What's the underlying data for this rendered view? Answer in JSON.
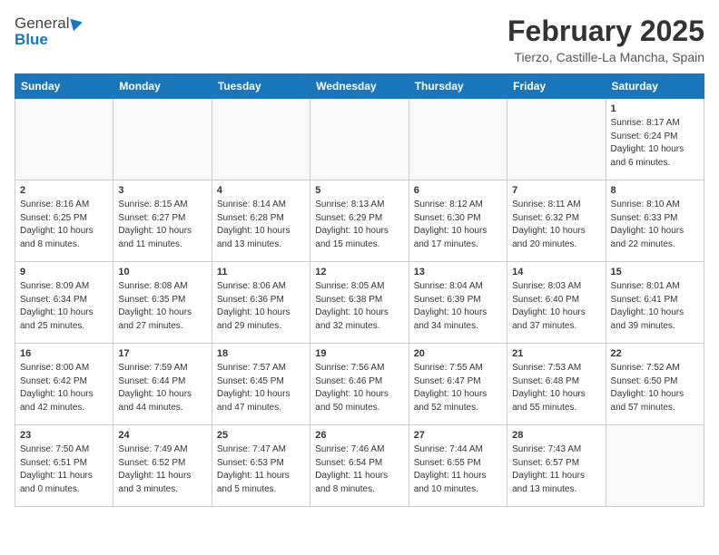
{
  "header": {
    "logo_general": "General",
    "logo_blue": "Blue",
    "month_year": "February 2025",
    "location": "Tierzo, Castille-La Mancha, Spain"
  },
  "weekdays": [
    "Sunday",
    "Monday",
    "Tuesday",
    "Wednesday",
    "Thursday",
    "Friday",
    "Saturday"
  ],
  "weeks": [
    [
      {
        "day": "",
        "info": ""
      },
      {
        "day": "",
        "info": ""
      },
      {
        "day": "",
        "info": ""
      },
      {
        "day": "",
        "info": ""
      },
      {
        "day": "",
        "info": ""
      },
      {
        "day": "",
        "info": ""
      },
      {
        "day": "1",
        "info": "Sunrise: 8:17 AM\nSunset: 6:24 PM\nDaylight: 10 hours\nand 6 minutes."
      }
    ],
    [
      {
        "day": "2",
        "info": "Sunrise: 8:16 AM\nSunset: 6:25 PM\nDaylight: 10 hours\nand 8 minutes."
      },
      {
        "day": "3",
        "info": "Sunrise: 8:15 AM\nSunset: 6:27 PM\nDaylight: 10 hours\nand 11 minutes."
      },
      {
        "day": "4",
        "info": "Sunrise: 8:14 AM\nSunset: 6:28 PM\nDaylight: 10 hours\nand 13 minutes."
      },
      {
        "day": "5",
        "info": "Sunrise: 8:13 AM\nSunset: 6:29 PM\nDaylight: 10 hours\nand 15 minutes."
      },
      {
        "day": "6",
        "info": "Sunrise: 8:12 AM\nSunset: 6:30 PM\nDaylight: 10 hours\nand 17 minutes."
      },
      {
        "day": "7",
        "info": "Sunrise: 8:11 AM\nSunset: 6:32 PM\nDaylight: 10 hours\nand 20 minutes."
      },
      {
        "day": "8",
        "info": "Sunrise: 8:10 AM\nSunset: 6:33 PM\nDaylight: 10 hours\nand 22 minutes."
      }
    ],
    [
      {
        "day": "9",
        "info": "Sunrise: 8:09 AM\nSunset: 6:34 PM\nDaylight: 10 hours\nand 25 minutes."
      },
      {
        "day": "10",
        "info": "Sunrise: 8:08 AM\nSunset: 6:35 PM\nDaylight: 10 hours\nand 27 minutes."
      },
      {
        "day": "11",
        "info": "Sunrise: 8:06 AM\nSunset: 6:36 PM\nDaylight: 10 hours\nand 29 minutes."
      },
      {
        "day": "12",
        "info": "Sunrise: 8:05 AM\nSunset: 6:38 PM\nDaylight: 10 hours\nand 32 minutes."
      },
      {
        "day": "13",
        "info": "Sunrise: 8:04 AM\nSunset: 6:39 PM\nDaylight: 10 hours\nand 34 minutes."
      },
      {
        "day": "14",
        "info": "Sunrise: 8:03 AM\nSunset: 6:40 PM\nDaylight: 10 hours\nand 37 minutes."
      },
      {
        "day": "15",
        "info": "Sunrise: 8:01 AM\nSunset: 6:41 PM\nDaylight: 10 hours\nand 39 minutes."
      }
    ],
    [
      {
        "day": "16",
        "info": "Sunrise: 8:00 AM\nSunset: 6:42 PM\nDaylight: 10 hours\nand 42 minutes."
      },
      {
        "day": "17",
        "info": "Sunrise: 7:59 AM\nSunset: 6:44 PM\nDaylight: 10 hours\nand 44 minutes."
      },
      {
        "day": "18",
        "info": "Sunrise: 7:57 AM\nSunset: 6:45 PM\nDaylight: 10 hours\nand 47 minutes."
      },
      {
        "day": "19",
        "info": "Sunrise: 7:56 AM\nSunset: 6:46 PM\nDaylight: 10 hours\nand 50 minutes."
      },
      {
        "day": "20",
        "info": "Sunrise: 7:55 AM\nSunset: 6:47 PM\nDaylight: 10 hours\nand 52 minutes."
      },
      {
        "day": "21",
        "info": "Sunrise: 7:53 AM\nSunset: 6:48 PM\nDaylight: 10 hours\nand 55 minutes."
      },
      {
        "day": "22",
        "info": "Sunrise: 7:52 AM\nSunset: 6:50 PM\nDaylight: 10 hours\nand 57 minutes."
      }
    ],
    [
      {
        "day": "23",
        "info": "Sunrise: 7:50 AM\nSunset: 6:51 PM\nDaylight: 11 hours\nand 0 minutes."
      },
      {
        "day": "24",
        "info": "Sunrise: 7:49 AM\nSunset: 6:52 PM\nDaylight: 11 hours\nand 3 minutes."
      },
      {
        "day": "25",
        "info": "Sunrise: 7:47 AM\nSunset: 6:53 PM\nDaylight: 11 hours\nand 5 minutes."
      },
      {
        "day": "26",
        "info": "Sunrise: 7:46 AM\nSunset: 6:54 PM\nDaylight: 11 hours\nand 8 minutes."
      },
      {
        "day": "27",
        "info": "Sunrise: 7:44 AM\nSunset: 6:55 PM\nDaylight: 11 hours\nand 10 minutes."
      },
      {
        "day": "28",
        "info": "Sunrise: 7:43 AM\nSunset: 6:57 PM\nDaylight: 11 hours\nand 13 minutes."
      },
      {
        "day": "",
        "info": ""
      }
    ]
  ]
}
